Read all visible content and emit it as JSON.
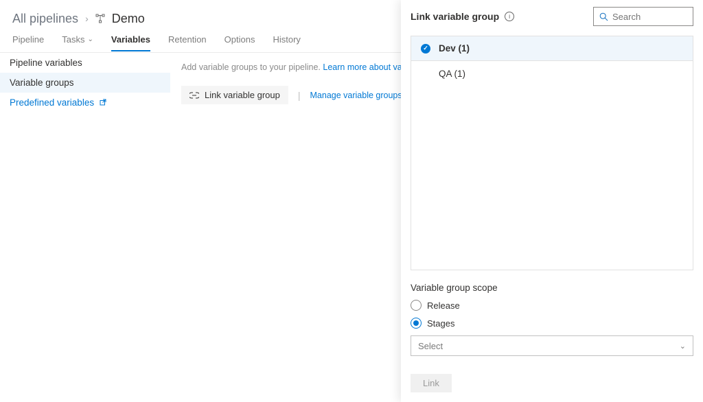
{
  "breadcrumb": {
    "root": "All pipelines",
    "current": "Demo"
  },
  "tabs": {
    "pipeline": "Pipeline",
    "tasks": "Tasks",
    "variables": "Variables",
    "retention": "Retention",
    "options": "Options",
    "history": "History"
  },
  "leftnav": {
    "pipeline_variables": "Pipeline variables",
    "variable_groups": "Variable groups",
    "predefined_variables": "Predefined variables"
  },
  "main": {
    "description_prefix": "Add variable groups to your pipeline. ",
    "description_link": "Learn more about variable g",
    "link_btn": "Link variable group",
    "manage_link": "Manage variable groups"
  },
  "panel": {
    "title": "Link variable group",
    "search_placeholder": "Search",
    "groups": [
      {
        "name": "Dev (1)",
        "selected": true
      },
      {
        "name": "QA (1)",
        "selected": false
      }
    ],
    "scope_title": "Variable group scope",
    "radio_release": "Release",
    "radio_stages": "Stages",
    "select_placeholder": "Select",
    "submit": "Link"
  }
}
